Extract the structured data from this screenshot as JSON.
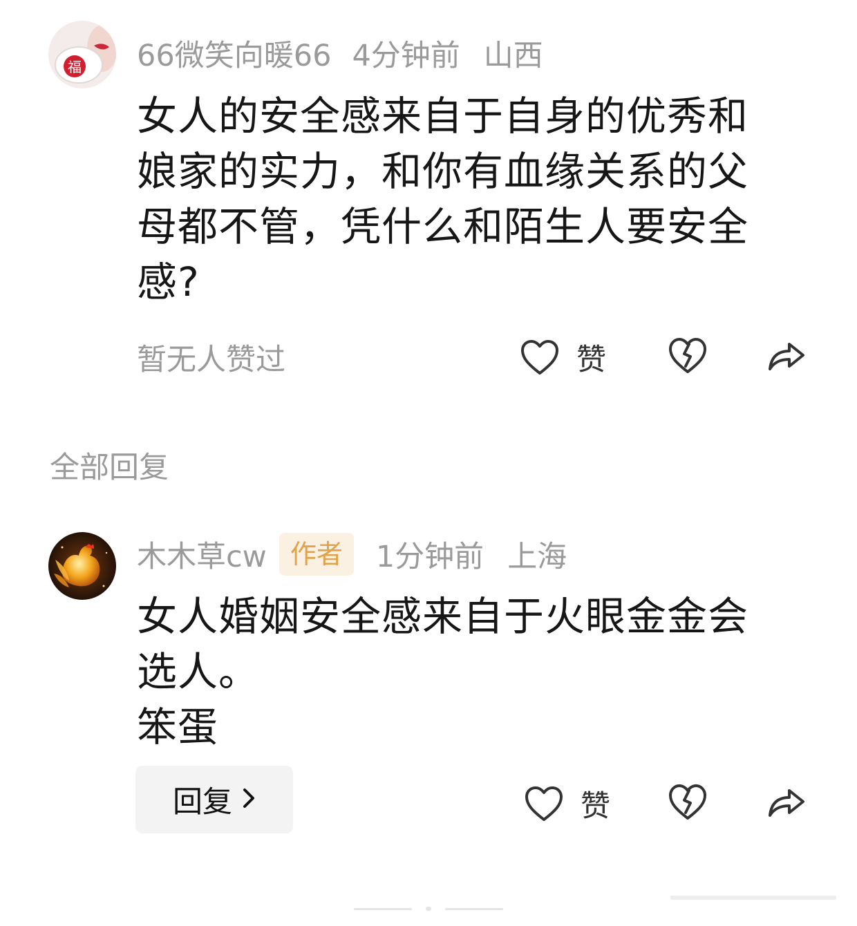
{
  "comment": {
    "username": "66微笑向暖66",
    "time": "4分钟前",
    "location": "山西",
    "text": "女人的安全感来自于自身的优秀和\n娘家的实力，和你有血缘关系的父\n母都不管，凭什么和陌生人要安全\n感?",
    "likes_text": "暂无人赞过",
    "like_label": "赞",
    "avatar_glyph": "福"
  },
  "replies_section": {
    "title": "全部回复"
  },
  "reply": {
    "username": "木木草cw",
    "badge": "作者",
    "time": "1分钟前",
    "location": "上海",
    "text": "女人婚姻安全感来自于火眼金金会\n选人。\n笨蛋",
    "reply_button_label": "回复",
    "like_label": "赞"
  },
  "icons": {
    "like": "heart-outline-icon",
    "dislike": "broken-heart-icon",
    "share": "share-arrow-icon",
    "chevron": "chevron-right-icon"
  },
  "colors": {
    "meta_gray": "#9a9a9a",
    "badge_bg": "#fbf1e3",
    "badge_text": "#e0a24a",
    "reply_btn_bg": "#f3f3f3"
  }
}
